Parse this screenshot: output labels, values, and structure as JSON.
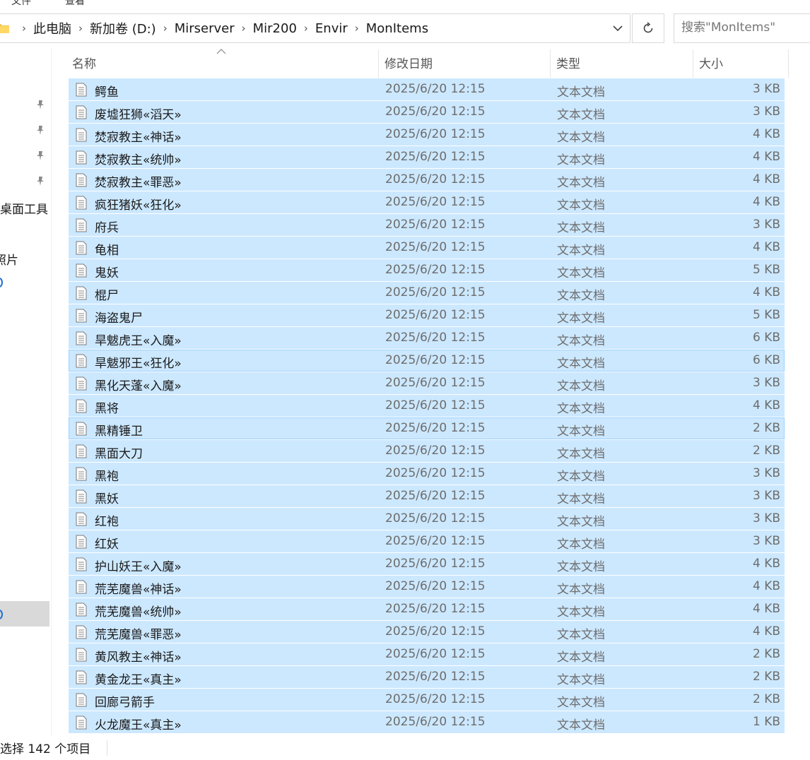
{
  "menu": {
    "items": [
      "文件",
      "查看"
    ]
  },
  "address_bar": {
    "crumbs": [
      "此电脑",
      "新加卷 (D:)",
      "Mirserver",
      "Mir200",
      "Envir",
      "MonItems"
    ],
    "dropdown_icon": "chevron-down-icon",
    "refresh_icon": "refresh-icon"
  },
  "search": {
    "placeholder": "搜索\"MonItems\""
  },
  "nav_pane": {
    "items": [
      "桌面工具",
      "照片"
    ]
  },
  "columns": {
    "name": "名称",
    "date": "修改日期",
    "type": "类型",
    "size": "大小"
  },
  "files": [
    {
      "name": "鳄鱼",
      "date": "2025/6/20 12:15",
      "type": "文本文档",
      "size": "3 KB"
    },
    {
      "name": "废墟狂狮«滔天»",
      "date": "2025/6/20 12:15",
      "type": "文本文档",
      "size": "3 KB"
    },
    {
      "name": "焚寂教主«神话»",
      "date": "2025/6/20 12:15",
      "type": "文本文档",
      "size": "4 KB"
    },
    {
      "name": "焚寂教主«统帅»",
      "date": "2025/6/20 12:15",
      "type": "文本文档",
      "size": "4 KB"
    },
    {
      "name": "焚寂教主«罪恶»",
      "date": "2025/6/20 12:15",
      "type": "文本文档",
      "size": "4 KB"
    },
    {
      "name": "疯狂猪妖«狂化»",
      "date": "2025/6/20 12:15",
      "type": "文本文档",
      "size": "4 KB"
    },
    {
      "name": "府兵",
      "date": "2025/6/20 12:15",
      "type": "文本文档",
      "size": "3 KB"
    },
    {
      "name": "龟相",
      "date": "2025/6/20 12:15",
      "type": "文本文档",
      "size": "4 KB"
    },
    {
      "name": "鬼妖",
      "date": "2025/6/20 12:15",
      "type": "文本文档",
      "size": "5 KB"
    },
    {
      "name": "棍尸",
      "date": "2025/6/20 12:15",
      "type": "文本文档",
      "size": "4 KB"
    },
    {
      "name": "海盗鬼尸",
      "date": "2025/6/20 12:15",
      "type": "文本文档",
      "size": "5 KB"
    },
    {
      "name": "旱魃虎王«入魔»",
      "date": "2025/6/20 12:15",
      "type": "文本文档",
      "size": "6 KB"
    },
    {
      "name": "旱魃邪王«狂化»",
      "date": "2025/6/20 12:15",
      "type": "文本文档",
      "size": "6 KB"
    },
    {
      "name": "黑化天蓬«入魔»",
      "date": "2025/6/20 12:15",
      "type": "文本文档",
      "size": "3 KB"
    },
    {
      "name": "黑将",
      "date": "2025/6/20 12:15",
      "type": "文本文档",
      "size": "4 KB"
    },
    {
      "name": "黑精锤卫",
      "date": "2025/6/20 12:15",
      "type": "文本文档",
      "size": "2 KB"
    },
    {
      "name": "黑面大刀",
      "date": "2025/6/20 12:15",
      "type": "文本文档",
      "size": "2 KB"
    },
    {
      "name": "黑袍",
      "date": "2025/6/20 12:15",
      "type": "文本文档",
      "size": "3 KB"
    },
    {
      "name": "黑妖",
      "date": "2025/6/20 12:15",
      "type": "文本文档",
      "size": "3 KB"
    },
    {
      "name": "红袍",
      "date": "2025/6/20 12:15",
      "type": "文本文档",
      "size": "3 KB"
    },
    {
      "name": "红妖",
      "date": "2025/6/20 12:15",
      "type": "文本文档",
      "size": "3 KB"
    },
    {
      "name": "护山妖王«入魔»",
      "date": "2025/6/20 12:15",
      "type": "文本文档",
      "size": "4 KB"
    },
    {
      "name": "荒芜魔兽«神话»",
      "date": "2025/6/20 12:15",
      "type": "文本文档",
      "size": "4 KB"
    },
    {
      "name": "荒芜魔兽«统帅»",
      "date": "2025/6/20 12:15",
      "type": "文本文档",
      "size": "4 KB"
    },
    {
      "name": "荒芜魔兽«罪恶»",
      "date": "2025/6/20 12:15",
      "type": "文本文档",
      "size": "4 KB"
    },
    {
      "name": "黄风教主«神话»",
      "date": "2025/6/20 12:15",
      "type": "文本文档",
      "size": "2 KB"
    },
    {
      "name": "黄金龙王«真主»",
      "date": "2025/6/20 12:15",
      "type": "文本文档",
      "size": "2 KB"
    },
    {
      "name": "回廊弓箭手",
      "date": "2025/6/20 12:15",
      "type": "文本文档",
      "size": "2 KB"
    },
    {
      "name": "火龙魔王«真主»",
      "date": "2025/6/20 12:15",
      "type": "文本文档",
      "size": "1 KB"
    }
  ],
  "status_bar": {
    "text": "选择 142 个项目"
  },
  "colors": {
    "selection": "#cce8ff",
    "selection_border": "#99d1ff",
    "accent": "#1f6fd1"
  }
}
